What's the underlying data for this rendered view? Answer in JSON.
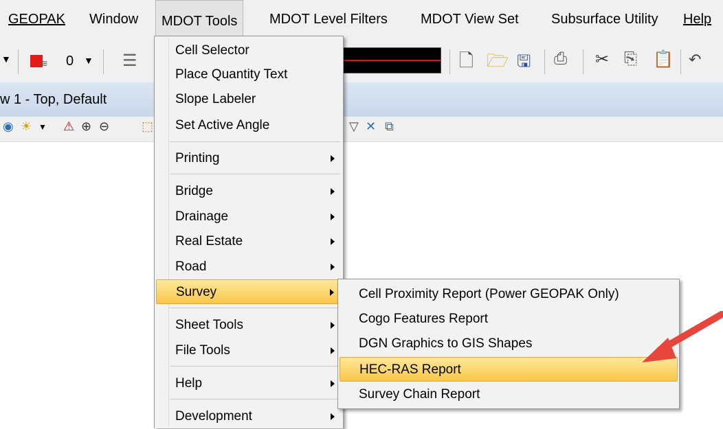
{
  "menubar": {
    "items": [
      "GEOPAK",
      "Window",
      "MDOT Tools",
      "MDOT Level Filters",
      "MDOT View Set",
      "Subsurface Utility",
      "Help"
    ]
  },
  "toolbar": {
    "level_value": "0"
  },
  "view": {
    "title": "w 1 - Top, Default"
  },
  "mdot_menu": {
    "items": [
      "Cell Selector",
      "Place Quantity Text",
      "Slope Labeler",
      "Set Active Angle",
      "Printing",
      "Bridge",
      "Drainage",
      "Real Estate",
      "Road",
      "Survey",
      "Sheet Tools",
      "File Tools",
      "Help",
      "Development"
    ]
  },
  "survey_menu": {
    "items": [
      "Cell Proximity Report (Power GEOPAK Only)",
      "Cogo Features Report",
      "DGN Graphics to GIS Shapes",
      "HEC-RAS Report",
      "Survey Chain Report"
    ]
  },
  "colors": {
    "highlight": "#f9c74a",
    "annotation_arrow": "#e8453c"
  }
}
